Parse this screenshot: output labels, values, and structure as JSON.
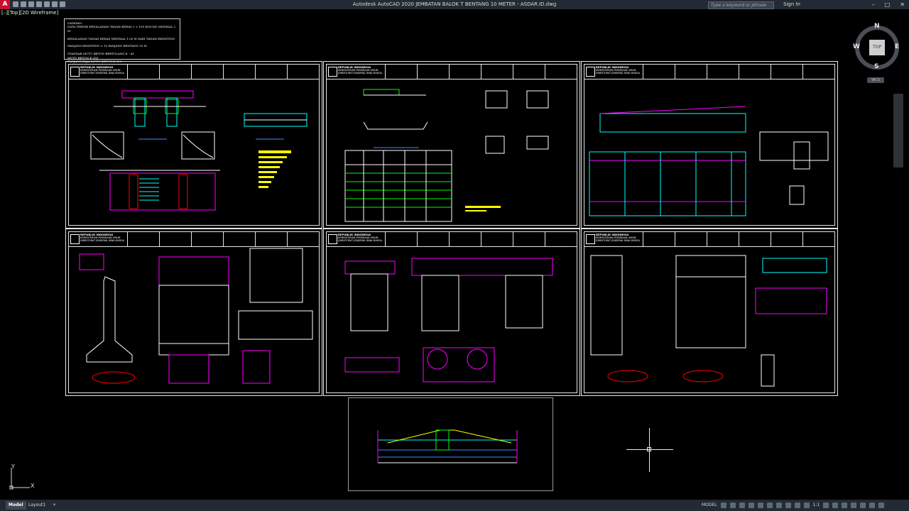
{
  "app": {
    "logo_letter": "A",
    "title": "Autodesk AutoCAD 2020   JEMBATAN BALOK T BENTANG 10 METER - ASDAR.ID.dwg",
    "search_placeholder": "Type a keyword or phrase",
    "sign_in": "Sign In",
    "window_controls": [
      "–",
      "□",
      "✕"
    ]
  },
  "viewport": {
    "label": "[–][Top][2D Wireframe]"
  },
  "notes": {
    "lines": [
      "CATATAN :",
      "DATA TEKNIK KEDALAMAN TANAH KERAS 2 > 150 KG/CM2 MINIMAL 2 M",
      "",
      "KEDALAMAN TANAH KERAS MINIMAL    1.00 M DARI TANAH EKSISTING",
      "",
      "PANJANG EKSISTING ± 10 PANJANG BENTANG 10 M",
      "",
      "STANDAR MUTU BETON BERTULANG K - A1",
      "MUTU BETON K 250",
      "PANJANG BAJA MUTU BETON K 350"
    ]
  },
  "sheet_header": {
    "org_title": "REPUBLIK INDONESIA",
    "org_line2": "KEMENTERIAN PEKERJAAN UMUM",
    "org_line3": "DIREKTORAT JENDERAL BINA MARGA"
  },
  "navcube": {
    "top": "TOP",
    "north": "N",
    "south": "S",
    "east": "E",
    "west": "W",
    "wcs": "WCS"
  },
  "ucs": {
    "x": "X",
    "y": "Y"
  },
  "status": {
    "tabs": [
      "Model",
      "Layout1"
    ],
    "add_tab": "+",
    "mode": "MODEL",
    "scale": "1:1"
  }
}
